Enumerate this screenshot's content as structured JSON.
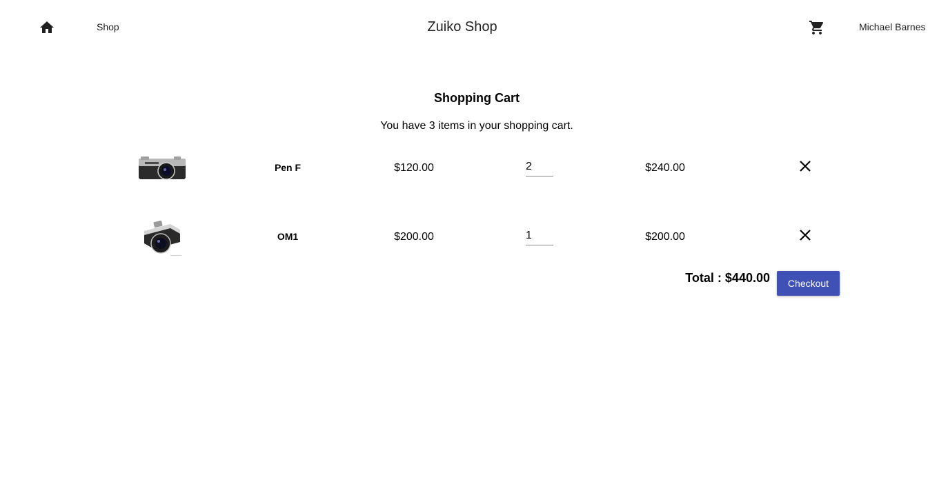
{
  "header": {
    "home_icon": "home-icon",
    "shop_label": "Shop",
    "title": "Zuiko Shop",
    "cart_icon": "shopping-cart-icon",
    "user_name": "Michael Barnes"
  },
  "cart": {
    "title": "Shopping Cart",
    "summary": "You have 3 items in your shopping cart.",
    "items": [
      {
        "name": "Pen F",
        "price": "$120.00",
        "quantity": "2",
        "subtotal": "$240.00",
        "image_icon": "camera-image"
      },
      {
        "name": "OM1",
        "price": "$200.00",
        "quantity": "1",
        "subtotal": "$200.00",
        "image_icon": "camera-image"
      }
    ],
    "remove_icon": "close-icon",
    "total": "Total : $440.00",
    "checkout_label": "Checkout"
  },
  "colors": {
    "primary": "#3f51b5",
    "text": "#212121"
  }
}
